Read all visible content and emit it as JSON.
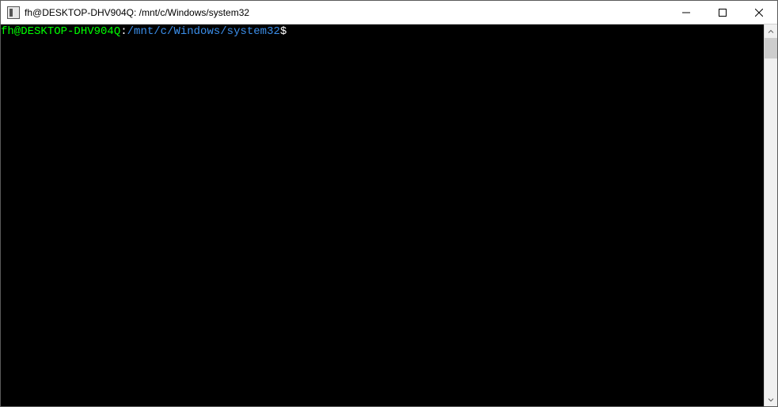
{
  "window": {
    "title": "fh@DESKTOP-DHV904Q: /mnt/c/Windows/system32"
  },
  "terminal": {
    "prompt": {
      "userhost": "fh@DESKTOP-DHV904Q",
      "colon": ":",
      "path": "/mnt/c/Windows/system32",
      "symbol": "$"
    }
  }
}
